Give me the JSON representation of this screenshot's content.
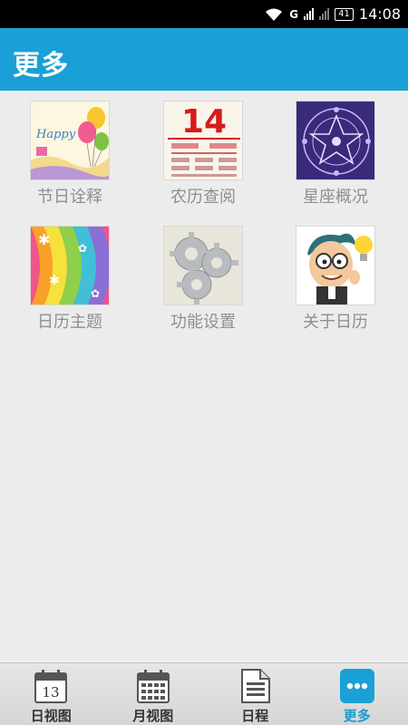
{
  "status_bar": {
    "network": "G",
    "sim1": "1",
    "sim2": "2",
    "battery": "41",
    "time": "14:08"
  },
  "header": {
    "title": "更多"
  },
  "grid": {
    "items": [
      {
        "label": "节日诠释",
        "icon": "balloon-icon"
      },
      {
        "label": "农历查阅",
        "icon": "calendar-14-icon"
      },
      {
        "label": "星座概况",
        "icon": "zodiac-icon"
      },
      {
        "label": "日历主题",
        "icon": "theme-icon"
      },
      {
        "label": "功能设置",
        "icon": "gears-icon"
      },
      {
        "label": "关于日历",
        "icon": "cartoon-face-icon"
      }
    ]
  },
  "calendar_thumb": {
    "number": "14"
  },
  "tabbar": {
    "tabs": [
      {
        "label": "日视图",
        "icon": "day-calendar-icon",
        "day": "13"
      },
      {
        "label": "月视图",
        "icon": "month-calendar-icon"
      },
      {
        "label": "日程",
        "icon": "schedule-doc-icon"
      },
      {
        "label": "更多",
        "icon": "more-dots-icon",
        "active": true
      }
    ]
  },
  "colors": {
    "accent": "#1aa0d6",
    "label": "#8f8f8f",
    "tab_active": "#1a9bd4"
  }
}
